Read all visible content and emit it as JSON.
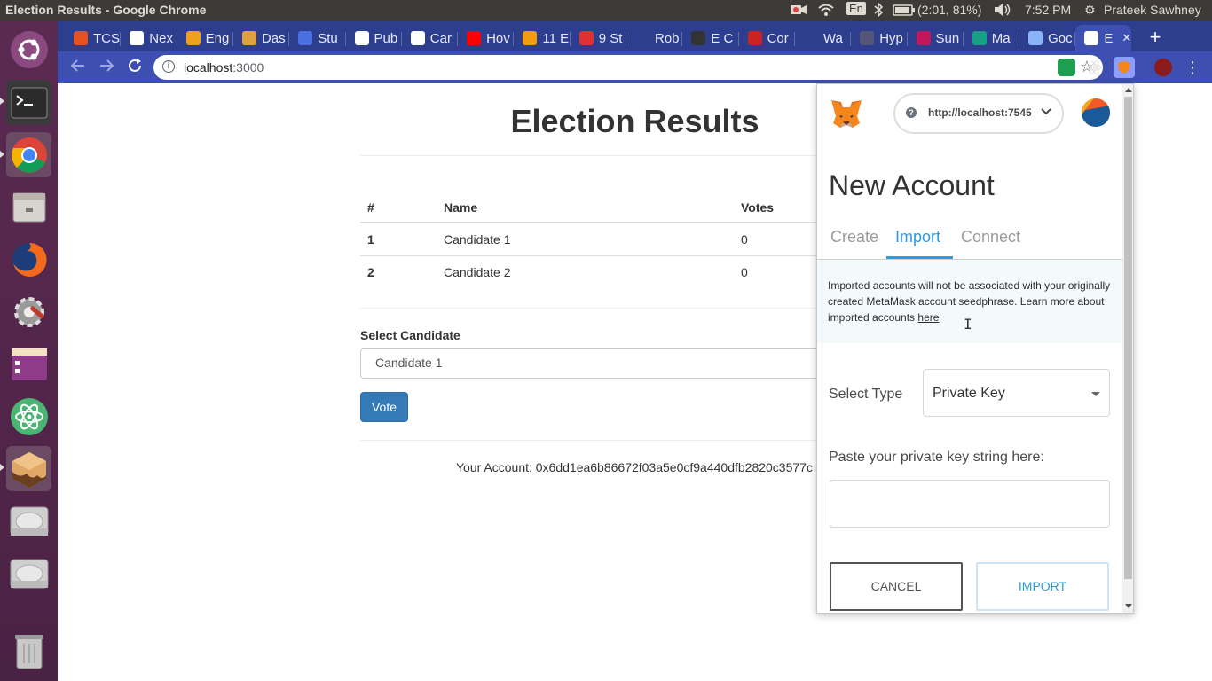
{
  "system": {
    "window_title": "Election Results - Google Chrome",
    "battery": "(2:01, 81%)",
    "clock": "7:52 PM",
    "user": "Prateek Sawhney",
    "keyboard": "En"
  },
  "browser": {
    "tabs": [
      {
        "label": "TCS",
        "color": "#e8501e"
      },
      {
        "label": "Nex",
        "color": "#ffffff"
      },
      {
        "label": "Eng",
        "color": "#f0a020"
      },
      {
        "label": "Das",
        "color": "#e0a040"
      },
      {
        "label": "Stu",
        "color": "#4a6fe0"
      },
      {
        "label": "Pub",
        "color": "#ffffff"
      },
      {
        "label": "Car",
        "color": "#ffffff"
      },
      {
        "label": "Hov",
        "color": "#ff0000"
      },
      {
        "label": "11 E",
        "color": "#f39c12"
      },
      {
        "label": "9 St",
        "color": "#e03030"
      },
      {
        "label": "Rob",
        "color": "#2e3e8f"
      },
      {
        "label": "E C",
        "color": "#333333"
      },
      {
        "label": "Cor",
        "color": "#cc2222"
      },
      {
        "label": "Wa",
        "color": "#2e3e8f"
      },
      {
        "label": "Hyp",
        "color": "#555577"
      },
      {
        "label": "Sun",
        "color": "#c2185b"
      },
      {
        "label": "Ma",
        "color": "#16a085"
      },
      {
        "label": "Goc",
        "color": "#8ab4f8"
      },
      {
        "label": "E",
        "color": "#ffffff"
      }
    ],
    "url_host": "localhost",
    "url_port": ":3000"
  },
  "page": {
    "title": "Election Results",
    "table": {
      "headers": [
        "#",
        "Name",
        "Votes"
      ],
      "rows": [
        {
          "id": "1",
          "name": "Candidate 1",
          "votes": "0"
        },
        {
          "id": "2",
          "name": "Candidate 2",
          "votes": "0"
        }
      ]
    },
    "select_label": "Select Candidate",
    "selected_candidate": "Candidate 1",
    "vote_button": "Vote",
    "account_line": "Your Account: 0x6dd1ea6b86672f03a5e0cf9a440dfb2820c3577c"
  },
  "metamask": {
    "network": "http://localhost:7545",
    "heading": "New Account",
    "tabs": [
      "Create",
      "Import",
      "Connect"
    ],
    "active_tab": "Import",
    "notice": "Imported accounts will not be associated with your originally created MetaMask account seedphrase. Learn more about imported accounts",
    "notice_link": "here",
    "select_type_label": "Select Type",
    "select_type_value": "Private Key",
    "key_label": "Paste your private key string here:",
    "key_value": "",
    "cancel_button": "CANCEL",
    "import_button": "IMPORT"
  },
  "colors": {
    "tabstrip": "#2e3e8f",
    "toolbar": "#3d4fb0",
    "launcher": "#5b2a52",
    "metamask_accent": "#2f9ae0",
    "vote_button": "#337ab7"
  }
}
